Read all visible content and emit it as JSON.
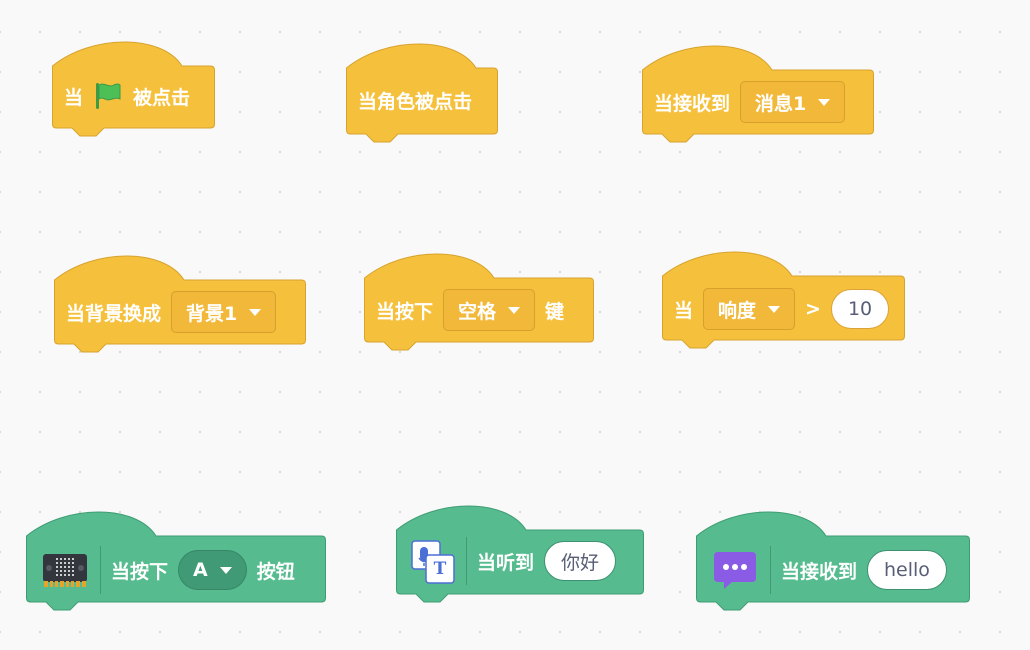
{
  "colors": {
    "events": "#f5c13c",
    "events_dark": "#d7a32e",
    "extension": "#56bc8f",
    "extension_dark": "#3e9c73",
    "flag": "#4cbf56"
  },
  "blocks": {
    "flag_clicked": {
      "when": "当",
      "icon": "green-flag-icon",
      "clicked": "被点击"
    },
    "sprite_clicked": {
      "label": "当角色被点击"
    },
    "receive_message": {
      "label": "当接收到",
      "menu": "消息1"
    },
    "backdrop_switch": {
      "label": "当背景换成",
      "menu": "背景1"
    },
    "key_pressed": {
      "label": "当按下",
      "menu": "空格",
      "suffix": "键"
    },
    "sensor_greater": {
      "label": "当",
      "menu": "响度",
      "op": ">",
      "value": "10"
    },
    "microbit_button": {
      "icon": "microbit-board-icon",
      "label": "当按下",
      "menu": "A",
      "suffix": "按钮"
    },
    "speech_heard": {
      "icon": "speech-to-text-icon",
      "icon_text": "T",
      "label": "当听到",
      "value": "你好"
    },
    "ai_message": {
      "icon": "chat-bubble-icon",
      "label": "当接收到",
      "value": "hello"
    }
  }
}
